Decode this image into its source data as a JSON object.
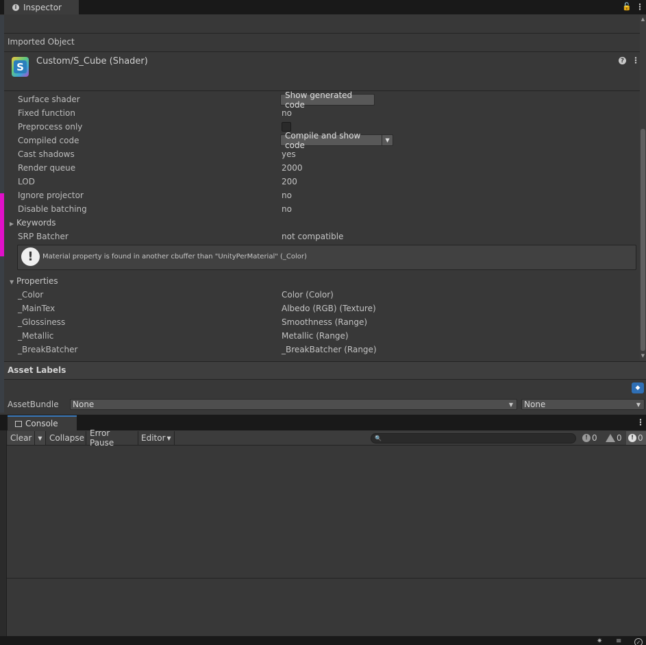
{
  "inspector": {
    "tab_label": "Inspector",
    "lock_icon": "lock-icon",
    "menu_icon": "kebab-menu-icon"
  },
  "header": {
    "section_title": "Imported Object",
    "shader_title": "Custom/S_Cube (Shader)",
    "shader_icon_letter": "S"
  },
  "properties": {
    "surface_shader_label": "Surface shader",
    "surface_shader_button": "Show generated code",
    "fixed_function_label": "Fixed function",
    "fixed_function_value": "no",
    "preprocess_label": "Preprocess only",
    "preprocess_checked": false,
    "compiled_code_label": "Compiled code",
    "compiled_code_button": "Compile and show code",
    "cast_shadows_label": "Cast shadows",
    "cast_shadows_value": "yes",
    "render_queue_label": "Render queue",
    "render_queue_value": "2000",
    "lod_label": "LOD",
    "lod_value": "200",
    "ignore_projector_label": "Ignore projector",
    "ignore_projector_value": "no",
    "disable_batching_label": "Disable batching",
    "disable_batching_value": "no",
    "keywords_label": "Keywords",
    "srp_batcher_label": "SRP Batcher",
    "srp_batcher_value": "not compatible",
    "warning_text": "Material property is found in another cbuffer than \"UnityPerMaterial\" (_Color)"
  },
  "shader_properties": {
    "title": "Properties",
    "items": [
      {
        "name": "_Color",
        "type": "Color (Color)"
      },
      {
        "name": "_MainTex",
        "type": "Albedo (RGB) (Texture)"
      },
      {
        "name": "_Glossiness",
        "type": "Smoothness (Range)"
      },
      {
        "name": "_Metallic",
        "type": "Metallic (Range)"
      },
      {
        "name": "_BreakBatcher",
        "type": "_BreakBatcher (Range)"
      }
    ]
  },
  "asset_labels": {
    "title": "Asset Labels",
    "assetbundle_label": "AssetBundle",
    "bundle_name": "None",
    "bundle_variant": "None"
  },
  "console": {
    "tab_label": "Console",
    "clear": "Clear",
    "collapse": "Collapse",
    "error_pause": "Error Pause",
    "editor": "Editor",
    "info_count": "0",
    "warning_count": "0",
    "error_count": "0"
  }
}
